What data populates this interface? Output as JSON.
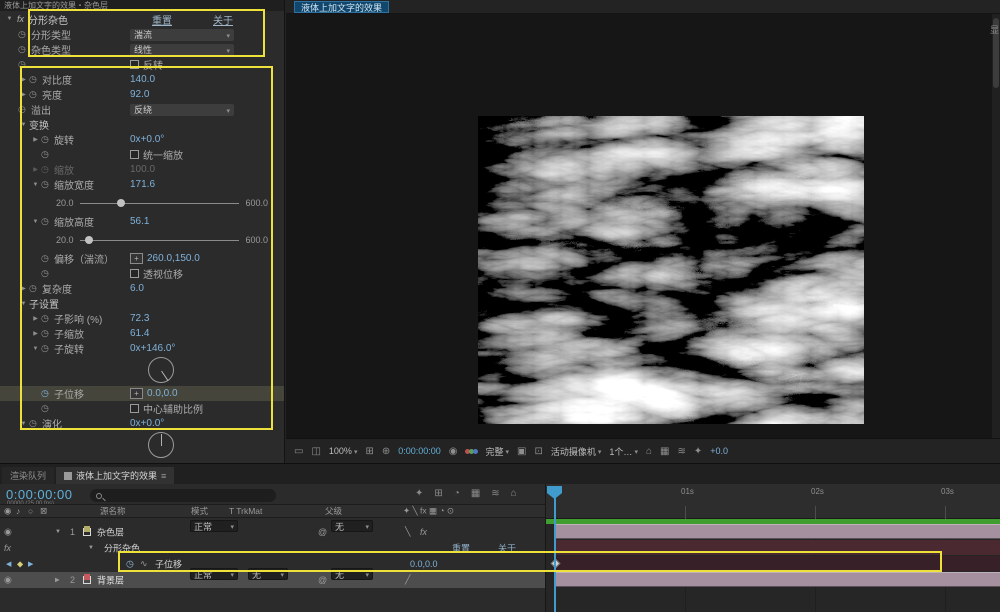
{
  "effect_panel": {
    "tab": "液体上加文字的效果・杂色层",
    "effect_name": "分形杂色",
    "reset": "重置",
    "about": "关于",
    "params": {
      "fractal_type": {
        "label": "分形类型",
        "value": "湍流"
      },
      "noise_type": {
        "label": "杂色类型",
        "value": "线性"
      },
      "invert": {
        "label": "反转"
      },
      "contrast": {
        "label": "对比度",
        "value": "140.0"
      },
      "brightness": {
        "label": "亮度",
        "value": "92.0"
      },
      "overflow": {
        "label": "溢出",
        "value": "反绕"
      },
      "transform_group": {
        "label": "变换"
      },
      "rotation": {
        "label": "旋转",
        "value": "0x+0.0°"
      },
      "uniform_scale": {
        "label": "统一缩放"
      },
      "scale": {
        "label": "缩放",
        "value": "100.0"
      },
      "scale_width": {
        "label": "缩放宽度",
        "value": "171.6",
        "min": "20.0",
        "max": "600.0"
      },
      "scale_height": {
        "label": "缩放高度",
        "value": "56.1",
        "min": "20.0",
        "max": "600.0"
      },
      "offset_turbulence": {
        "label": "偏移（湍流）",
        "value": "260.0,150.0"
      },
      "perspective_offset": {
        "label": "透视位移"
      },
      "complexity": {
        "label": "复杂度",
        "value": "6.0"
      },
      "sub_settings_group": {
        "label": "子设置"
      },
      "sub_influence": {
        "label": "子影响 (%)",
        "value": "72.3"
      },
      "sub_scale": {
        "label": "子缩放",
        "value": "61.4"
      },
      "sub_rotation": {
        "label": "子旋转",
        "value": "0x+146.0°"
      },
      "sub_offset": {
        "label": "子位移",
        "value": "0.0,0.0"
      },
      "center_subscale": {
        "label": "中心辅助比例"
      },
      "evolution": {
        "label": "演化",
        "value": "0x+0.0°"
      }
    }
  },
  "comp_panel": {
    "tab": "液体上加文字的效果",
    "corner_label": "显",
    "toolbar": {
      "zoom": "100%",
      "time": "0:00:00:00",
      "resolution": "完整",
      "camera": "活动摄像机",
      "views": "1个…",
      "exposure": "+0.0"
    }
  },
  "timeline": {
    "tab_render_queue": "渲染队列",
    "tab_comp": "液体上加文字的效果",
    "time": "0:00:00:00",
    "time_sub": "00000 (25.00 fps)",
    "columns": {
      "source_name": "源名称",
      "mode": "模式",
      "trkmat": "T TrkMat",
      "parent": "父级"
    },
    "layers": {
      "noise": {
        "num": "1",
        "name": "杂色层",
        "mode": "正常",
        "parent": "无"
      },
      "background": {
        "num": "2",
        "name": "背景层",
        "mode": "正常",
        "trkmat": "无",
        "parent": "无"
      }
    },
    "effect_row": {
      "name": "分形杂色",
      "reset": "重置",
      "about": "关于"
    },
    "property_row": {
      "label": "子位移",
      "value": "0.0,0.0"
    },
    "ruler": {
      "s1": "01s",
      "s2": "02s",
      "s3": "03s"
    }
  },
  "icons": {
    "stopwatch": "◷",
    "crosshair": "+",
    "eye": "◉",
    "audio": "♪",
    "solo": "○",
    "lock": "⊠",
    "menu": "≡",
    "pickwhip": "@",
    "keyframe": "◆",
    "twirl_open": "▼",
    "twirl_closed": "▶",
    "dropdown_arrow": "▾"
  }
}
